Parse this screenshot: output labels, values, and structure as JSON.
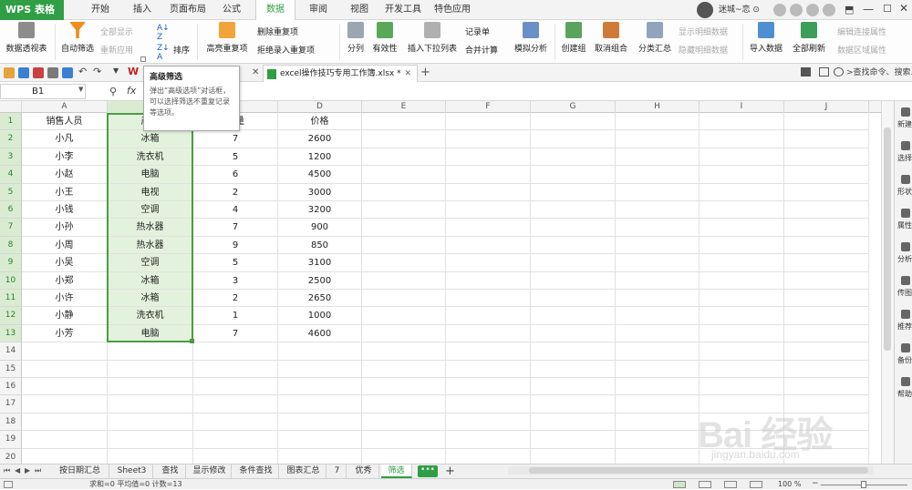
{
  "app": {
    "name": "WPS 表格",
    "brand_color": "#2f9e44"
  },
  "menu": {
    "tabs": [
      "开始",
      "插入",
      "页面布局",
      "公式",
      "数据",
      "审阅",
      "视图",
      "开发工具",
      "特色应用"
    ],
    "active_index": 4
  },
  "user": {
    "name": "迷城~恋 ⊙"
  },
  "ribbon": {
    "pivot": "数据透视表",
    "auto_filter": "自动筛选",
    "show_all": "全部显示",
    "reapply": "重新应用",
    "sort": "排序",
    "highlight_dup": "高亮重复项",
    "remove_dup": "删除重复项",
    "reject_dup": "拒绝录入重复项",
    "split": "分列",
    "validity": "有效性",
    "dropdown": "插入下拉列表",
    "record": "记录单",
    "consolidate": "合并计算",
    "simulate": "模拟分析",
    "group": "创建组",
    "ungroup": "取消组合",
    "subtotal": "分类汇总",
    "show_detail": "显示明细数据",
    "hide_detail": "隐藏明细数据",
    "import": "导入数据",
    "refresh_all": "全部刷新",
    "edit_conn": "编辑连接属性",
    "range_prop": "数据区域属性"
  },
  "tooltip": {
    "title": "高级筛选",
    "body": "弹出“高级选项”对话框，可以选择筛选不重复记录等选项。"
  },
  "document": {
    "tab": "excel操作技巧专用工作簿.xlsx *"
  },
  "search": {
    "placeholder": ">查找命令、搜索..."
  },
  "namebox": "B1",
  "columns": [
    "A",
    "B",
    "C",
    "D",
    "E",
    "F",
    "G",
    "H",
    "I",
    "J"
  ],
  "rows": [
    [
      "销售人员",
      "产品",
      "数量",
      "价格"
    ],
    [
      "小凡",
      "冰箱",
      "7",
      "2600"
    ],
    [
      "小李",
      "洗衣机",
      "5",
      "1200"
    ],
    [
      "小赵",
      "电脑",
      "6",
      "4500"
    ],
    [
      "小王",
      "电视",
      "2",
      "3000"
    ],
    [
      "小钱",
      "空调",
      "4",
      "3200"
    ],
    [
      "小孙",
      "热水器",
      "7",
      "900"
    ],
    [
      "小周",
      "热水器",
      "9",
      "850"
    ],
    [
      "小吴",
      "空调",
      "5",
      "3100"
    ],
    [
      "小郑",
      "冰箱",
      "3",
      "2500"
    ],
    [
      "小许",
      "冰箱",
      "2",
      "2650"
    ],
    [
      "小静",
      "洗衣机",
      "1",
      "1000"
    ],
    [
      "小芳",
      "电脑",
      "7",
      "4600"
    ]
  ],
  "row_numbers": [
    "1",
    "2",
    "3",
    "4",
    "5",
    "6",
    "7",
    "8",
    "9",
    "10",
    "11",
    "12",
    "13",
    "14",
    "15",
    "16",
    "17",
    "18",
    "19",
    "20"
  ],
  "taskpane": [
    "新建",
    "选择",
    "形状",
    "属性",
    "分析",
    "传图",
    "推荐",
    "备份",
    "帮助"
  ],
  "sheets": [
    "按日期汇总",
    "Sheet3",
    "查找",
    "显示修改",
    "条件查找",
    "图表汇总",
    "7",
    "优秀",
    "筛选"
  ],
  "active_sheet": "筛选",
  "status": {
    "text": "求和=0  平均值=0  计数=13",
    "zoom": "100 %"
  },
  "watermark": {
    "text": "Bai 经验",
    "sub": "jingyan.baidu.com"
  }
}
